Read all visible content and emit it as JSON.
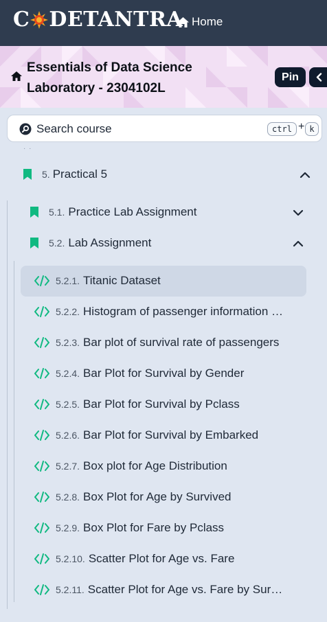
{
  "header": {
    "logo_text": "CODETANTRA",
    "logo_prefix": "C",
    "logo_rest": "DETANTRA",
    "home_label": "Home",
    "bg_color": "#2f3c4f"
  },
  "course": {
    "title": "Essentials of Data Science Laboratory - 2304102L",
    "pin_label": "Pin"
  },
  "search": {
    "placeholder": "Search course",
    "shortcut_key1": "ctrl",
    "shortcut_plus": "+",
    "shortcut_key2": "k"
  },
  "tree": {
    "unit": {
      "num": "5.",
      "label": "Practical 5",
      "expanded": true
    },
    "sections": [
      {
        "num": "5.1.",
        "label": "Practice Lab Assignment",
        "expanded": false
      },
      {
        "num": "5.2.",
        "label": "Lab Assignment",
        "expanded": true
      }
    ],
    "items": [
      {
        "num": "5.2.1.",
        "label": "Titanic Dataset",
        "active": true
      },
      {
        "num": "5.2.2.",
        "label": "Histogram of passenger information …"
      },
      {
        "num": "5.2.3.",
        "label": "Bar plot of survival rate of passengers"
      },
      {
        "num": "5.2.4.",
        "label": "Bar Plot for Survival by Gender"
      },
      {
        "num": "5.2.5.",
        "label": "Bar Plot for Survival by Pclass"
      },
      {
        "num": "5.2.6.",
        "label": "Bar Plot for Survival by Embarked"
      },
      {
        "num": "5.2.7.",
        "label": "Box plot for Age Distribution"
      },
      {
        "num": "5.2.8.",
        "label": "Box Plot for Age by Survived"
      },
      {
        "num": "5.2.9.",
        "label": "Box Plot for Fare by Pclass"
      },
      {
        "num": "5.2.10.",
        "label": "Scatter Plot for Age vs. Fare"
      },
      {
        "num": "5.2.11.",
        "label": "Scatter Plot for Age vs. Fare by Sur…"
      }
    ]
  },
  "colors": {
    "accent_green": "#10b981",
    "dark_button": "#0f1b2d",
    "sidebar_bg": "#dfe6f1",
    "active_row": "#cfd8e6"
  },
  "icons": {
    "home": "home-icon",
    "search": "search-icon",
    "bookmark": "bookmark-icon",
    "code": "code-icon",
    "chevron_up": "chevron-up-icon",
    "chevron_down": "chevron-down-icon",
    "chevron_left": "chevron-left-icon"
  }
}
